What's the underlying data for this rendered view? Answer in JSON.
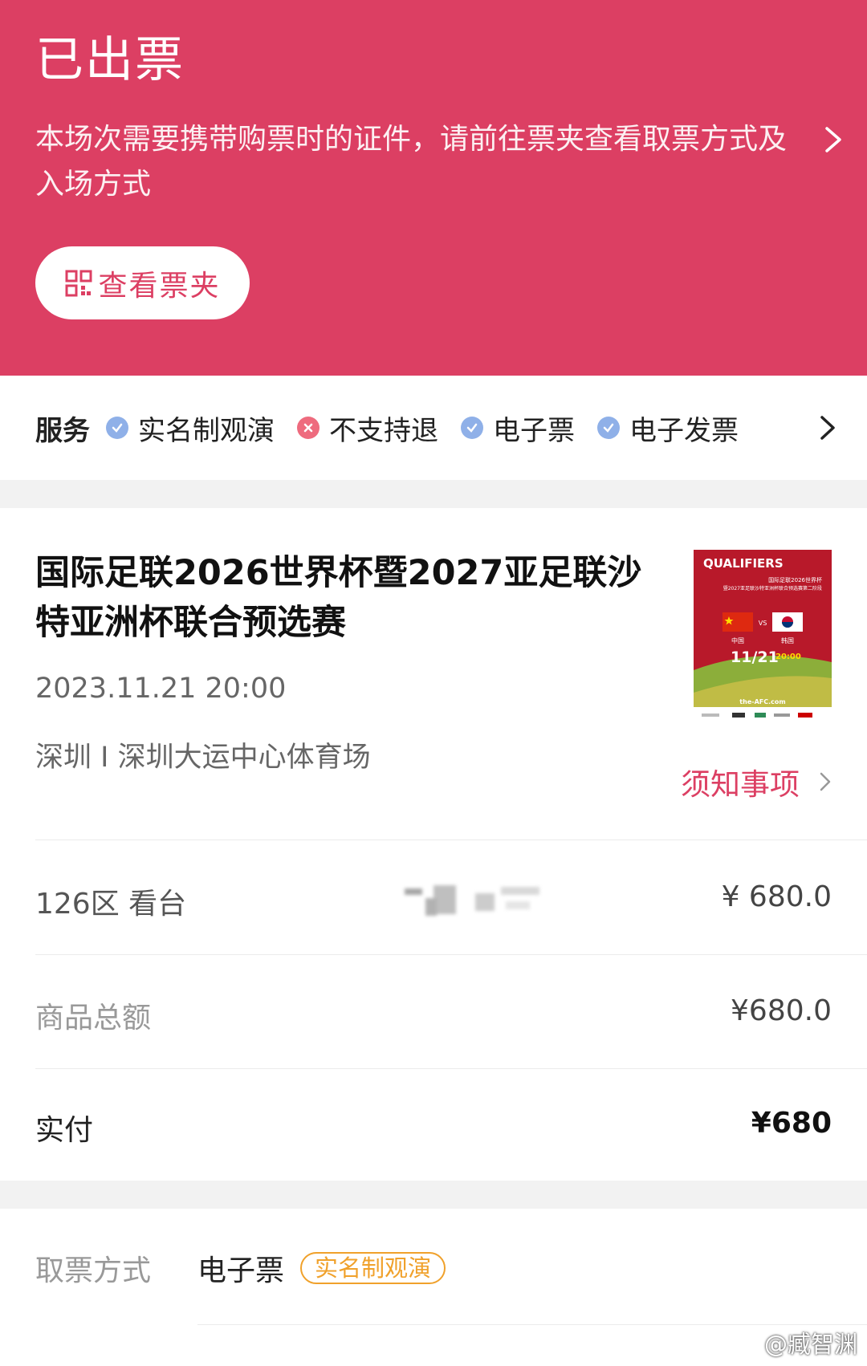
{
  "header": {
    "status": "已出票",
    "notice": "本场次需要携带购票时的证件，请前往票夹查看取票方式及入场方式",
    "ticket_folder_button": "查看票夹"
  },
  "services": {
    "label": "服务",
    "items": [
      {
        "label": "实名制观演",
        "icon": "check-circle-icon",
        "color": "#8fb0e8"
      },
      {
        "label": "不支持退",
        "icon": "cross-circle-icon",
        "color": "#ee6b7e"
      },
      {
        "label": "电子票",
        "icon": "check-circle-icon",
        "color": "#8fb0e8"
      },
      {
        "label": "电子发票",
        "icon": "check-circle-icon",
        "color": "#8fb0e8"
      }
    ]
  },
  "event": {
    "title": "国际足联2026世界杯暨2027亚足联沙特亚洲杯联合预选赛",
    "datetime": "2023.11.21 20:00",
    "venue": "深圳 I 深圳大运中心体育场",
    "notes_link": "须知事项",
    "poster": {
      "brand": "QUALIFIERS",
      "line1": "国际足联2026世界杯",
      "line2": "暨2027亚足联沙特亚洲杯联合预选赛第二阶段",
      "team_home": "中国",
      "team_away": "韩国",
      "vs": "VS",
      "date": "11/21",
      "time": "20:00",
      "website": "the-AFC.com"
    }
  },
  "order": {
    "seat_area": "126区 看台",
    "seat_price": "¥  680.0",
    "subtotal_label": "商品总额",
    "subtotal_value": "¥680.0",
    "paid_label": "实付",
    "paid_value": "¥680"
  },
  "pickup": {
    "label": "取票方式",
    "value": "电子票",
    "tag": "实名制观演"
  },
  "watermark": "@臧智渊",
  "colors": {
    "brand_pink": "#dc3f63",
    "tag_orange": "#f0a12b"
  }
}
